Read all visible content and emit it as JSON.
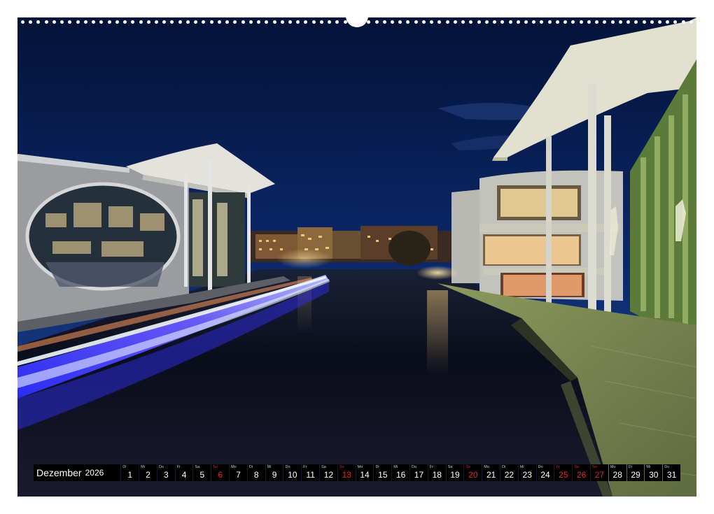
{
  "calendar": {
    "month": "Dezember",
    "year": "2026",
    "days": [
      {
        "d": "1",
        "w": "Di",
        "red": false
      },
      {
        "d": "2",
        "w": "Mi",
        "red": false
      },
      {
        "d": "3",
        "w": "Do",
        "red": false
      },
      {
        "d": "4",
        "w": "Fr",
        "red": false
      },
      {
        "d": "5",
        "w": "Sa",
        "red": false
      },
      {
        "d": "6",
        "w": "So",
        "red": true
      },
      {
        "d": "7",
        "w": "Mo",
        "red": false
      },
      {
        "d": "8",
        "w": "Di",
        "red": false
      },
      {
        "d": "9",
        "w": "Mi",
        "red": false
      },
      {
        "d": "10",
        "w": "Do",
        "red": false
      },
      {
        "d": "11",
        "w": "Fr",
        "red": false
      },
      {
        "d": "12",
        "w": "Sa",
        "red": false
      },
      {
        "d": "13",
        "w": "So",
        "red": true
      },
      {
        "d": "14",
        "w": "Mo",
        "red": false
      },
      {
        "d": "15",
        "w": "Di",
        "red": false
      },
      {
        "d": "16",
        "w": "Mi",
        "red": false
      },
      {
        "d": "17",
        "w": "Do",
        "red": false
      },
      {
        "d": "18",
        "w": "Fr",
        "red": false
      },
      {
        "d": "19",
        "w": "Sa",
        "red": false
      },
      {
        "d": "20",
        "w": "So",
        "red": true
      },
      {
        "d": "21",
        "w": "Mo",
        "red": false
      },
      {
        "d": "22",
        "w": "Di",
        "red": false
      },
      {
        "d": "23",
        "w": "Mi",
        "red": false
      },
      {
        "d": "24",
        "w": "Do",
        "red": false
      },
      {
        "d": "25",
        "w": "Fr",
        "red": true
      },
      {
        "d": "26",
        "w": "Sa",
        "red": true
      },
      {
        "d": "27",
        "w": "So",
        "red": true
      },
      {
        "d": "28",
        "w": "Mo",
        "red": false
      },
      {
        "d": "29",
        "w": "Di",
        "red": false
      },
      {
        "d": "30",
        "w": "Mi",
        "red": false
      },
      {
        "d": "31",
        "w": "Do",
        "red": false
      }
    ]
  },
  "colors": {
    "sky_top": "#041640",
    "sky_bottom": "#1c3f8c",
    "water": "#0b0f1e",
    "light_trail_blue": "#4b4bff",
    "light_trail_white": "#e8f2ff",
    "building_light": "#ffd98a",
    "promenade": "#9aa66a",
    "holiday_red": "#e02a2a"
  }
}
